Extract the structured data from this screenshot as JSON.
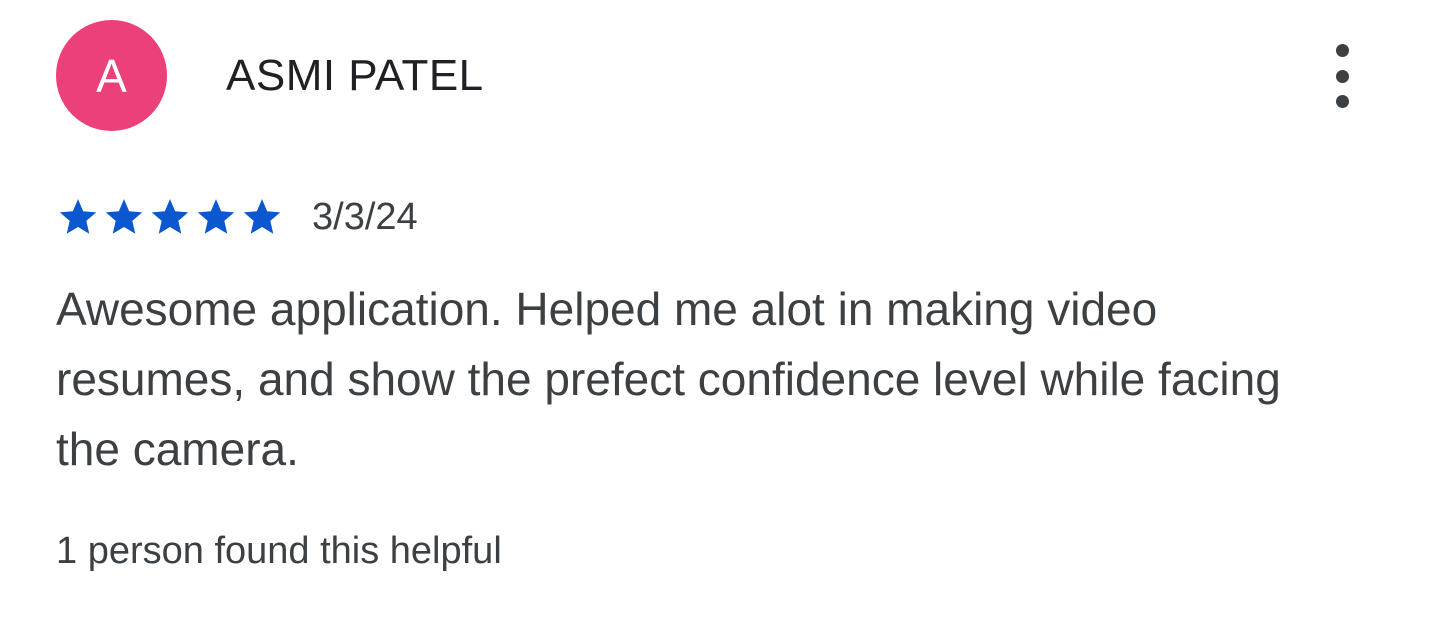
{
  "review": {
    "avatar_initial": "A",
    "author_name": "ASMI PATEL",
    "more_icon": "more-vert-icon",
    "rating": 5,
    "rating_max": 5,
    "star_color": "#0b57d0",
    "avatar_color": "#ec407a",
    "date": "3/3/24",
    "text": "Awesome application. Helped me alot in making video resumes, and show the prefect confidence level while facing the camera.",
    "helpful_text": "1 person found this helpful"
  }
}
